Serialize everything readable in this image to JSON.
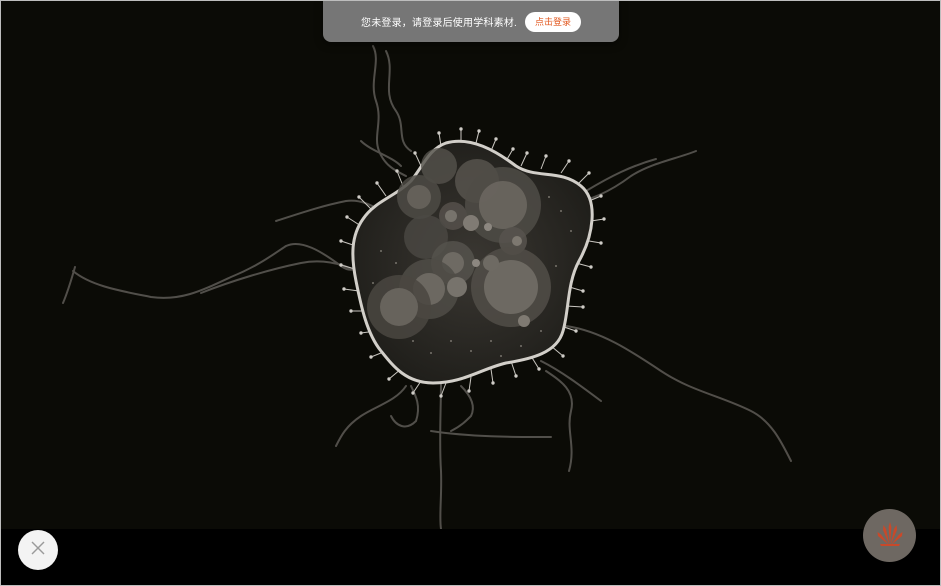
{
  "notice": {
    "message": "您未登录，请登录后使用学科素材.",
    "login_button": "点击登录"
  },
  "controls": {
    "close_icon": "close-icon",
    "brand_icon": "brand-logo-icon"
  },
  "colors": {
    "background": "#0b0b06",
    "toast_background": "#808080",
    "login_text": "#e2571e",
    "brand_red": "#c8492a"
  }
}
